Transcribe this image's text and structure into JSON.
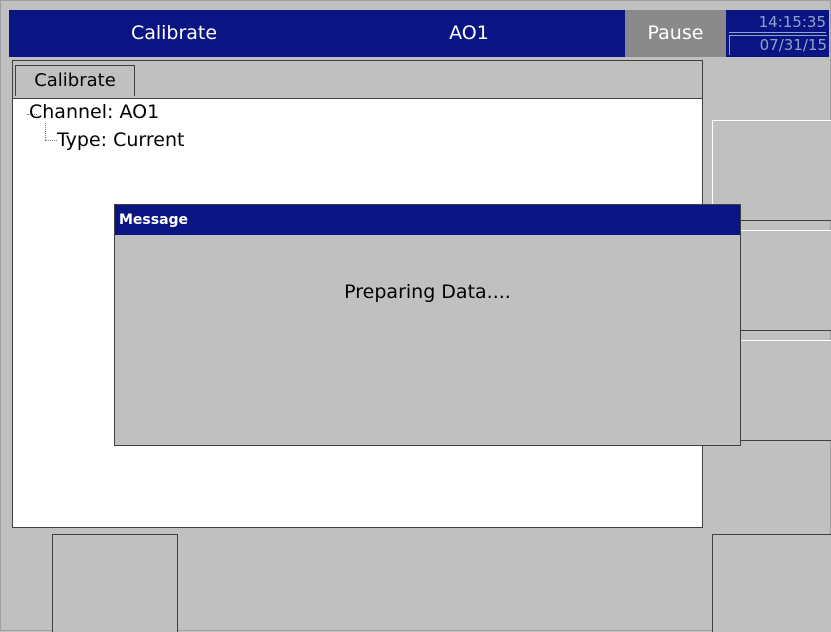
{
  "header": {
    "title": "Calibrate",
    "channel": "AO1",
    "status": "Pause",
    "time": "14:15:35",
    "date": "07/31/15"
  },
  "tabs": [
    {
      "label": "Calibrate"
    }
  ],
  "tree": {
    "channel": "Channel: AO1",
    "type": "Type: Current"
  },
  "dialog": {
    "title": "Message",
    "message": "Preparing Data...."
  },
  "colors": {
    "header_bg": "#0a1482",
    "status_bg": "#8a8a8a",
    "panel_bg": "#c0c0c0",
    "content_bg": "#ffffff"
  }
}
